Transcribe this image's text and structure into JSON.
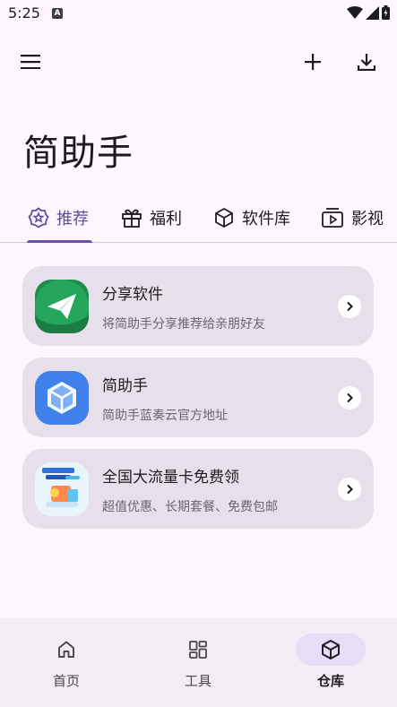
{
  "status_bar": {
    "time": "5:25",
    "notification_letter": "A"
  },
  "app_bar": {
    "menu_icon": "menu-icon",
    "add_icon": "plus-icon",
    "download_icon": "download-icon"
  },
  "page_title": "简助手",
  "tabs": [
    {
      "label": "推荐",
      "icon": "star-badge-icon",
      "active": true
    },
    {
      "label": "福利",
      "icon": "gift-icon",
      "active": false
    },
    {
      "label": "软件库",
      "icon": "cube-icon",
      "active": false
    },
    {
      "label": "影视",
      "icon": "tv-play-icon",
      "active": false
    }
  ],
  "cards": [
    {
      "title": "分享软件",
      "subtitle": "将简助手分享推荐给亲朋好友",
      "icon": "paper-plane-icon",
      "icon_color": "#1e8e4e"
    },
    {
      "title": "简助手",
      "subtitle": "简助手蓝奏云官方地址",
      "icon": "cube-app-icon",
      "icon_color": "#3d7de6"
    },
    {
      "title": "全国大流量卡免费领",
      "subtitle": "超值优惠、长期套餐、免费包邮",
      "icon": "sim-card-promo-icon",
      "icon_color": "#e8f3fb"
    }
  ],
  "bottom_nav": [
    {
      "label": "首页",
      "icon": "home-icon",
      "active": false
    },
    {
      "label": "工具",
      "icon": "grid-icon",
      "active": false
    },
    {
      "label": "仓库",
      "icon": "cube-icon",
      "active": true
    }
  ],
  "colors": {
    "accent": "#6750a4",
    "background": "#fdf7fd",
    "card": "#e7e0eb"
  }
}
